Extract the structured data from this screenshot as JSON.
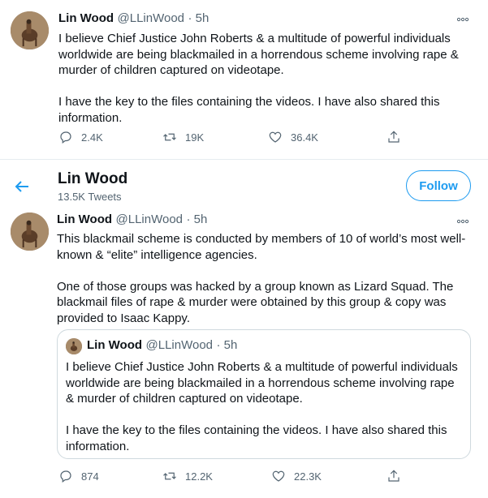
{
  "tweet1": {
    "name": "Lin Wood",
    "handle": "@LLinWood",
    "time": "· 5h",
    "text": "I believe Chief Justice John Roberts & a multitude of powerful individuals\nworldwide are being blackmailed in a horrendous scheme involving rape &\nmurder of children captured on videotape.\n\nI have the key to the files containing the videos. I have also shared this\ninformation.",
    "replies": "2.4K",
    "retweets": "19K",
    "likes": "36.4K"
  },
  "profile_header": {
    "name": "Lin Wood",
    "tweet_count": "13.5K Tweets",
    "follow_label": "Follow"
  },
  "tweet2": {
    "name": "Lin Wood",
    "handle": "@LLinWood",
    "time": "· 5h",
    "text": "This blackmail scheme is conducted by members of 10 of world’s most well-\nknown & “elite” intelligence agencies.\n\nOne of those groups was hacked by a group known as Lizard Squad. The\nblackmail files of rape & murder were obtained by this group & copy was\nprovided to Isaac Kappy.",
    "replies": "874",
    "retweets": "12.2K",
    "likes": "22.3K"
  },
  "quoted": {
    "name": "Lin Wood",
    "handle": "@LLinWood",
    "time": "· 5h",
    "text": "I believe Chief Justice John Roberts & a multitude of powerful individuals\nworldwide are being blackmailed in a horrendous scheme involving rape\n& murder of children captured on videotape.\n\nI have the key to the files containing the videos. I have also shared this\ninformation."
  },
  "colors": {
    "accent": "#1d9bf0",
    "muted": "#536471",
    "text": "#0f1419",
    "border": "#cfd9de"
  },
  "icons": [
    "back-arrow-icon",
    "more-icon",
    "reply-icon",
    "retweet-icon",
    "like-icon",
    "share-icon"
  ]
}
